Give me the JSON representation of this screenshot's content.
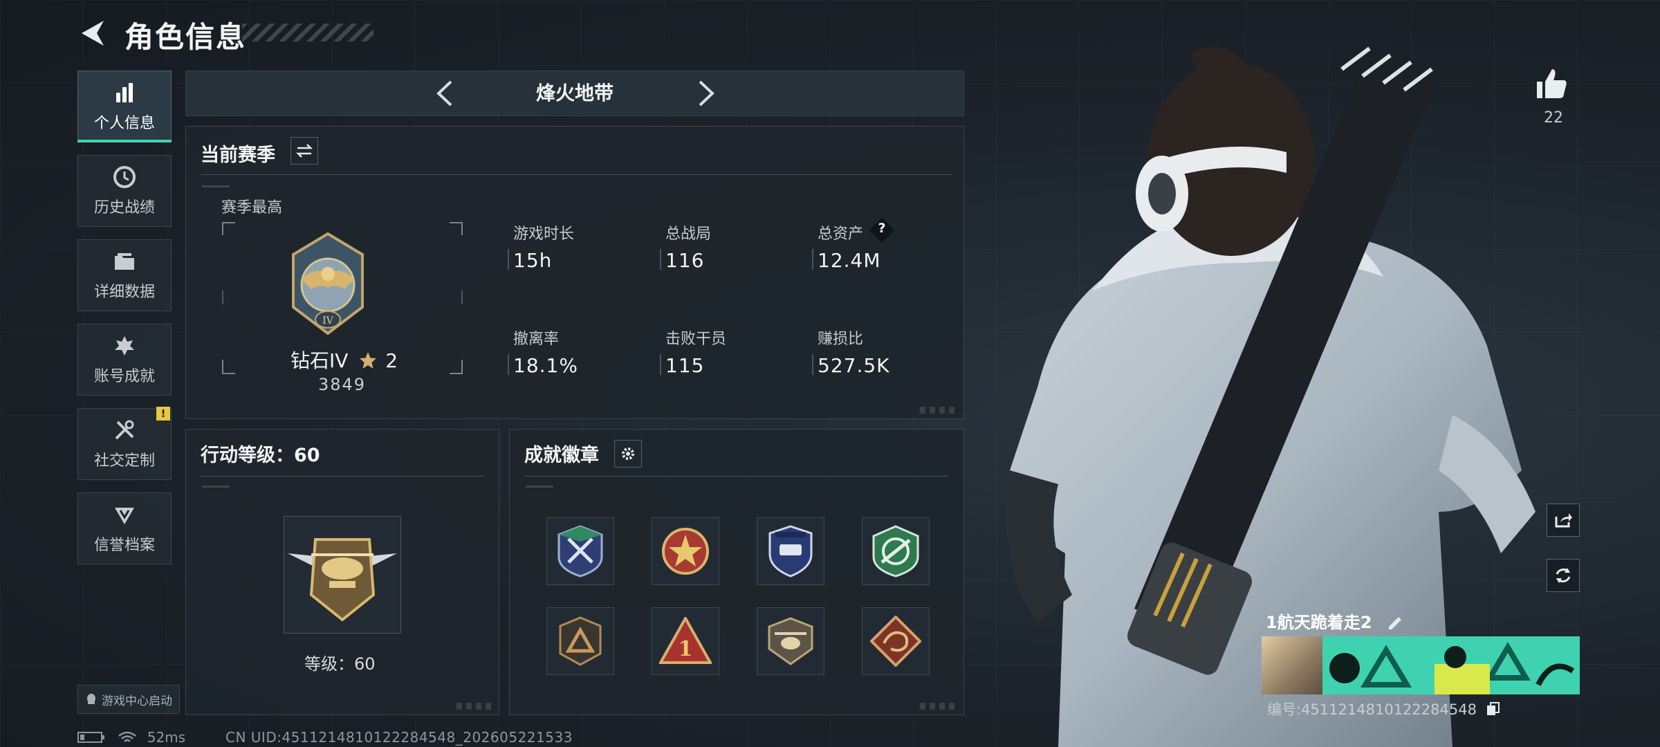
{
  "header": {
    "title": "角色信息"
  },
  "sidebar": {
    "items": [
      {
        "label": "个人信息",
        "icon": "bar-chart-icon",
        "active": true
      },
      {
        "label": "历史战绩",
        "icon": "history-clock-icon"
      },
      {
        "label": "详细数据",
        "icon": "folder-icon"
      },
      {
        "label": "账号成就",
        "icon": "achievement-icon"
      },
      {
        "label": "社交定制",
        "icon": "tools-icon",
        "badge": "!"
      },
      {
        "label": "信誉档案",
        "icon": "credit-shield-icon"
      }
    ],
    "launcher_label": "游戏中心启动"
  },
  "mode": {
    "name": "烽火地带"
  },
  "season": {
    "title": "当前赛季",
    "subtitle": "赛季最高",
    "rank_name": "钻石IV",
    "rank_stars": "2",
    "rank_score": "3849",
    "stats": [
      {
        "label": "游戏时长",
        "value": "15h"
      },
      {
        "label": "总战局",
        "value": "116"
      },
      {
        "label": "总资产",
        "value": "12.4M",
        "help": "?"
      },
      {
        "label": "撤离率",
        "value": "18.1%"
      },
      {
        "label": "击败干员",
        "value": "115"
      },
      {
        "label": "赚损比",
        "value": "527.5K"
      }
    ]
  },
  "action_level": {
    "title": "行动等级：60",
    "level_label": "等级：60"
  },
  "achievements": {
    "title": "成就徽章",
    "badges": [
      "blue-crossed-swords-badge",
      "red-star-badge",
      "blue-shield-badge",
      "green-rifle-badge",
      "bronze-triangle-badge",
      "red-number-one-badge",
      "helicopter-badge",
      "dragon-badge"
    ]
  },
  "profile": {
    "likes": "22",
    "name": "1航天跪着走2",
    "id_text": "编号:4511214810122284548"
  },
  "status": {
    "ping": "52ms",
    "uid": "CN UID:4511214810122284548_202605221533"
  },
  "colors": {
    "accent": "#3ed6a8",
    "badge_yellow": "#e8c645",
    "banner": "#3fd2b0"
  }
}
